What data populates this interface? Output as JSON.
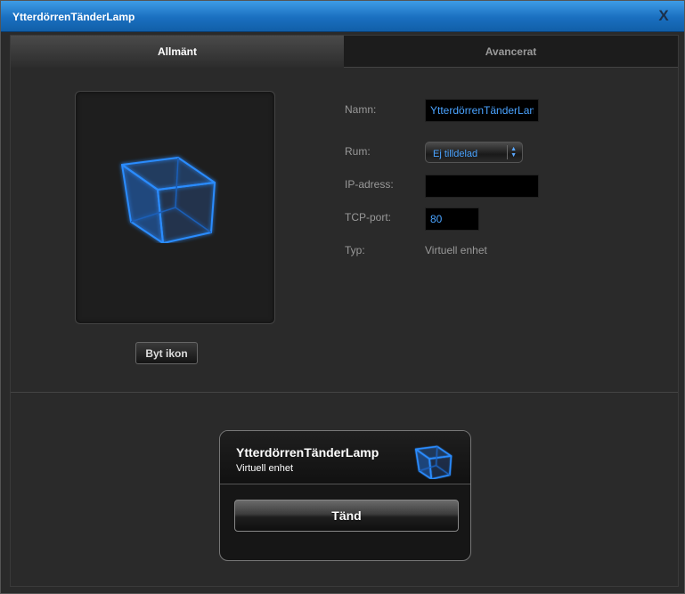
{
  "window": {
    "title": "YtterdörrenTänderLamp",
    "close_label": "X"
  },
  "tabs": [
    {
      "label": "Allmänt",
      "active": true
    },
    {
      "label": "Avancerat",
      "active": false
    }
  ],
  "icon_panel": {
    "icon": "cube-icon",
    "change_icon_label": "Byt ikon"
  },
  "form": {
    "name_label": "Namn:",
    "name_value": "YtterdörrenTänderLamp",
    "room_label": "Rum:",
    "room_value": "Ej tilldelad",
    "ip_label": "IP-adress:",
    "ip_value": "",
    "port_label": "TCP-port:",
    "port_value": "80",
    "type_label": "Typ:",
    "type_value": "Virtuell enhet"
  },
  "widget": {
    "name": "YtterdörrenTänderLamp",
    "type": "Virtuell enhet",
    "icon": "cube-icon",
    "on_label": "Tänd"
  },
  "colors": {
    "title_bar": "#1a6fc0",
    "accent_text": "#4aa3ff",
    "background": "#2a2a2a"
  }
}
